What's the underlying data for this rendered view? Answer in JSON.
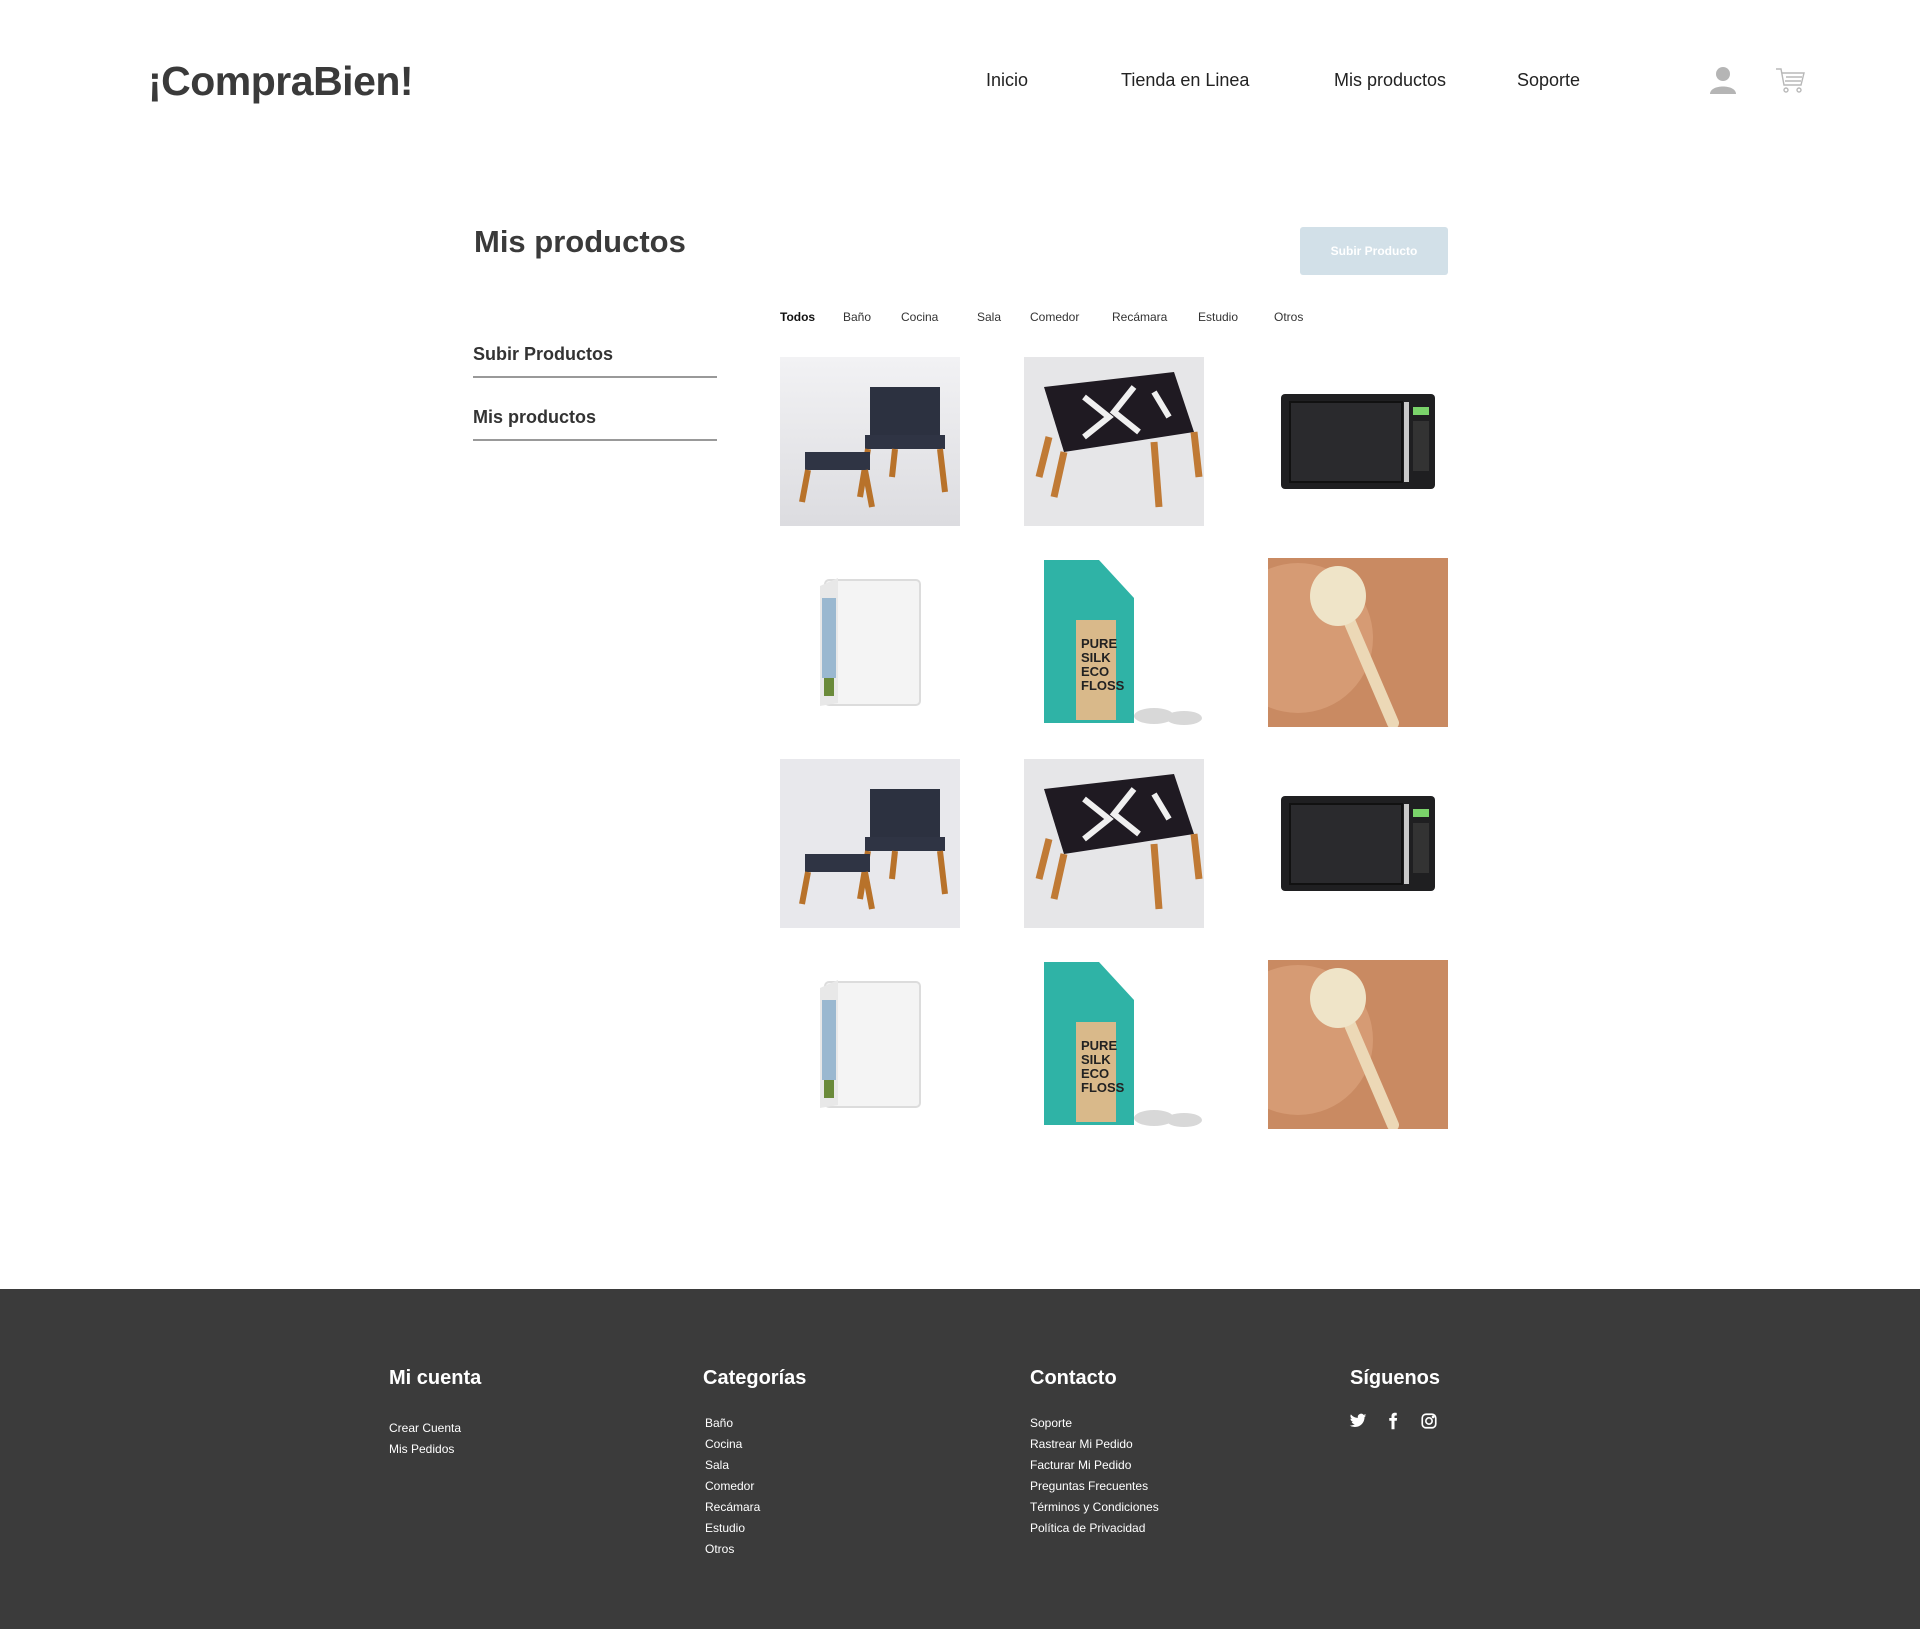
{
  "header": {
    "logo": "¡CompraBien!",
    "nav": [
      "Inicio",
      "Tienda en Linea",
      "Mis productos",
      "Soporte"
    ],
    "icons": [
      "user-icon",
      "cart-icon"
    ]
  },
  "main": {
    "title": "Mis productos",
    "upload_button": "Subir Producto",
    "side_menu": [
      "Subir Productos",
      "Mis productos"
    ],
    "tabs": [
      "Todos",
      "Baño",
      "Cocina",
      "Sala",
      "Comedor",
      "Recámara",
      "Estudio",
      "Otros"
    ],
    "active_tab": "Todos",
    "products": [
      "rope-chair-with-ottoman",
      "woven-bench",
      "black-microwave",
      "mini-fridge",
      "eco-floss-box",
      "dish-brush",
      "rope-chair-with-ottoman",
      "woven-bench",
      "black-microwave",
      "mini-fridge",
      "eco-floss-box",
      "dish-brush"
    ]
  },
  "footer": {
    "cuenta": {
      "title": "Mi cuenta",
      "links": [
        "Crear Cuenta",
        "Mis Pedidos"
      ]
    },
    "categorias": {
      "title": "Categorías",
      "links": [
        "Baño",
        "Cocina",
        "Sala",
        "Comedor",
        "Recámara",
        "Estudio",
        "Otros"
      ]
    },
    "contacto": {
      "title": "Contacto",
      "links": [
        "Soporte",
        "Rastrear Mi Pedido",
        "Facturar Mi Pedido",
        "Preguntas Frecuentes",
        "Términos y Condiciones",
        "Política de Privacidad"
      ]
    },
    "siguenos": {
      "title": "Síguenos",
      "icons": [
        "twitter-icon",
        "facebook-icon",
        "instagram-icon"
      ]
    }
  },
  "colors": {
    "button_bg": "#d2e0e8",
    "footer_bg": "#3b3b3b",
    "text_dark": "#3a3a3a"
  }
}
